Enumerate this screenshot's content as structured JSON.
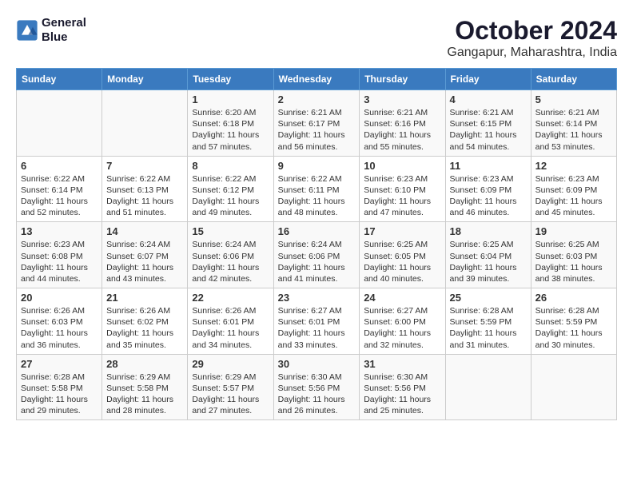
{
  "logo": {
    "line1": "General",
    "line2": "Blue"
  },
  "title": "October 2024",
  "subtitle": "Gangapur, Maharashtra, India",
  "headers": [
    "Sunday",
    "Monday",
    "Tuesday",
    "Wednesday",
    "Thursday",
    "Friday",
    "Saturday"
  ],
  "weeks": [
    [
      {
        "day": "",
        "sunrise": "",
        "sunset": "",
        "daylight": ""
      },
      {
        "day": "",
        "sunrise": "",
        "sunset": "",
        "daylight": ""
      },
      {
        "day": "1",
        "sunrise": "Sunrise: 6:20 AM",
        "sunset": "Sunset: 6:18 PM",
        "daylight": "Daylight: 11 hours and 57 minutes."
      },
      {
        "day": "2",
        "sunrise": "Sunrise: 6:21 AM",
        "sunset": "Sunset: 6:17 PM",
        "daylight": "Daylight: 11 hours and 56 minutes."
      },
      {
        "day": "3",
        "sunrise": "Sunrise: 6:21 AM",
        "sunset": "Sunset: 6:16 PM",
        "daylight": "Daylight: 11 hours and 55 minutes."
      },
      {
        "day": "4",
        "sunrise": "Sunrise: 6:21 AM",
        "sunset": "Sunset: 6:15 PM",
        "daylight": "Daylight: 11 hours and 54 minutes."
      },
      {
        "day": "5",
        "sunrise": "Sunrise: 6:21 AM",
        "sunset": "Sunset: 6:14 PM",
        "daylight": "Daylight: 11 hours and 53 minutes."
      }
    ],
    [
      {
        "day": "6",
        "sunrise": "Sunrise: 6:22 AM",
        "sunset": "Sunset: 6:14 PM",
        "daylight": "Daylight: 11 hours and 52 minutes."
      },
      {
        "day": "7",
        "sunrise": "Sunrise: 6:22 AM",
        "sunset": "Sunset: 6:13 PM",
        "daylight": "Daylight: 11 hours and 51 minutes."
      },
      {
        "day": "8",
        "sunrise": "Sunrise: 6:22 AM",
        "sunset": "Sunset: 6:12 PM",
        "daylight": "Daylight: 11 hours and 49 minutes."
      },
      {
        "day": "9",
        "sunrise": "Sunrise: 6:22 AM",
        "sunset": "Sunset: 6:11 PM",
        "daylight": "Daylight: 11 hours and 48 minutes."
      },
      {
        "day": "10",
        "sunrise": "Sunrise: 6:23 AM",
        "sunset": "Sunset: 6:10 PM",
        "daylight": "Daylight: 11 hours and 47 minutes."
      },
      {
        "day": "11",
        "sunrise": "Sunrise: 6:23 AM",
        "sunset": "Sunset: 6:09 PM",
        "daylight": "Daylight: 11 hours and 46 minutes."
      },
      {
        "day": "12",
        "sunrise": "Sunrise: 6:23 AM",
        "sunset": "Sunset: 6:09 PM",
        "daylight": "Daylight: 11 hours and 45 minutes."
      }
    ],
    [
      {
        "day": "13",
        "sunrise": "Sunrise: 6:23 AM",
        "sunset": "Sunset: 6:08 PM",
        "daylight": "Daylight: 11 hours and 44 minutes."
      },
      {
        "day": "14",
        "sunrise": "Sunrise: 6:24 AM",
        "sunset": "Sunset: 6:07 PM",
        "daylight": "Daylight: 11 hours and 43 minutes."
      },
      {
        "day": "15",
        "sunrise": "Sunrise: 6:24 AM",
        "sunset": "Sunset: 6:06 PM",
        "daylight": "Daylight: 11 hours and 42 minutes."
      },
      {
        "day": "16",
        "sunrise": "Sunrise: 6:24 AM",
        "sunset": "Sunset: 6:06 PM",
        "daylight": "Daylight: 11 hours and 41 minutes."
      },
      {
        "day": "17",
        "sunrise": "Sunrise: 6:25 AM",
        "sunset": "Sunset: 6:05 PM",
        "daylight": "Daylight: 11 hours and 40 minutes."
      },
      {
        "day": "18",
        "sunrise": "Sunrise: 6:25 AM",
        "sunset": "Sunset: 6:04 PM",
        "daylight": "Daylight: 11 hours and 39 minutes."
      },
      {
        "day": "19",
        "sunrise": "Sunrise: 6:25 AM",
        "sunset": "Sunset: 6:03 PM",
        "daylight": "Daylight: 11 hours and 38 minutes."
      }
    ],
    [
      {
        "day": "20",
        "sunrise": "Sunrise: 6:26 AM",
        "sunset": "Sunset: 6:03 PM",
        "daylight": "Daylight: 11 hours and 36 minutes."
      },
      {
        "day": "21",
        "sunrise": "Sunrise: 6:26 AM",
        "sunset": "Sunset: 6:02 PM",
        "daylight": "Daylight: 11 hours and 35 minutes."
      },
      {
        "day": "22",
        "sunrise": "Sunrise: 6:26 AM",
        "sunset": "Sunset: 6:01 PM",
        "daylight": "Daylight: 11 hours and 34 minutes."
      },
      {
        "day": "23",
        "sunrise": "Sunrise: 6:27 AM",
        "sunset": "Sunset: 6:01 PM",
        "daylight": "Daylight: 11 hours and 33 minutes."
      },
      {
        "day": "24",
        "sunrise": "Sunrise: 6:27 AM",
        "sunset": "Sunset: 6:00 PM",
        "daylight": "Daylight: 11 hours and 32 minutes."
      },
      {
        "day": "25",
        "sunrise": "Sunrise: 6:28 AM",
        "sunset": "Sunset: 5:59 PM",
        "daylight": "Daylight: 11 hours and 31 minutes."
      },
      {
        "day": "26",
        "sunrise": "Sunrise: 6:28 AM",
        "sunset": "Sunset: 5:59 PM",
        "daylight": "Daylight: 11 hours and 30 minutes."
      }
    ],
    [
      {
        "day": "27",
        "sunrise": "Sunrise: 6:28 AM",
        "sunset": "Sunset: 5:58 PM",
        "daylight": "Daylight: 11 hours and 29 minutes."
      },
      {
        "day": "28",
        "sunrise": "Sunrise: 6:29 AM",
        "sunset": "Sunset: 5:58 PM",
        "daylight": "Daylight: 11 hours and 28 minutes."
      },
      {
        "day": "29",
        "sunrise": "Sunrise: 6:29 AM",
        "sunset": "Sunset: 5:57 PM",
        "daylight": "Daylight: 11 hours and 27 minutes."
      },
      {
        "day": "30",
        "sunrise": "Sunrise: 6:30 AM",
        "sunset": "Sunset: 5:56 PM",
        "daylight": "Daylight: 11 hours and 26 minutes."
      },
      {
        "day": "31",
        "sunrise": "Sunrise: 6:30 AM",
        "sunset": "Sunset: 5:56 PM",
        "daylight": "Daylight: 11 hours and 25 minutes."
      },
      {
        "day": "",
        "sunrise": "",
        "sunset": "",
        "daylight": ""
      },
      {
        "day": "",
        "sunrise": "",
        "sunset": "",
        "daylight": ""
      }
    ]
  ]
}
